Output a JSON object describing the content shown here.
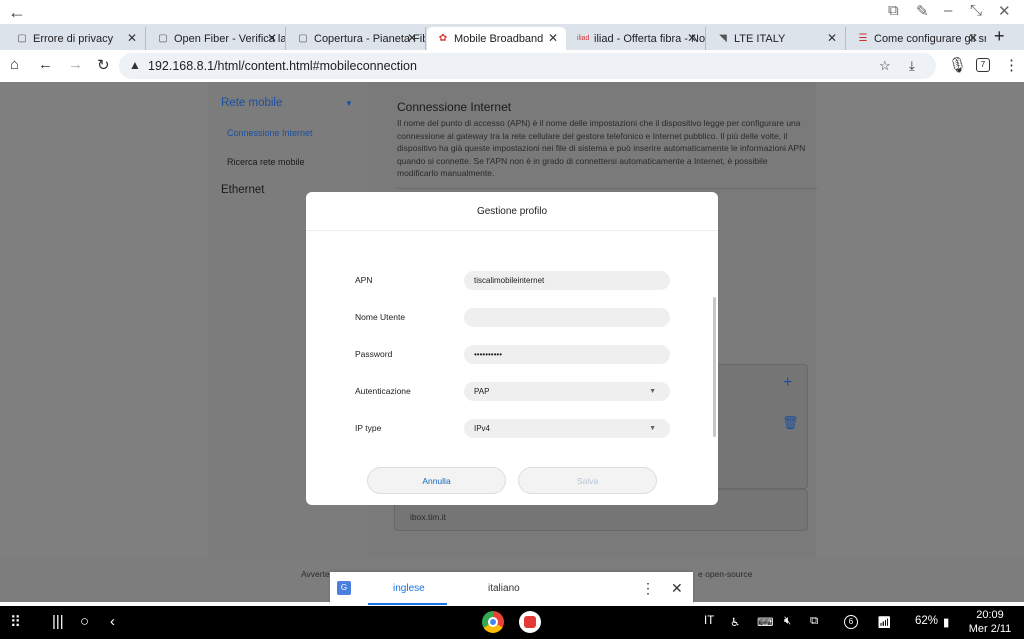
{
  "tabs": [
    {
      "label": "Errore di privacy",
      "icon": "doc-icon",
      "active": false
    },
    {
      "label": "Open Fiber - Verifica la c",
      "icon": "doc-icon",
      "active": false
    },
    {
      "label": "Copertura - Pianeta Fibr",
      "icon": "doc-icon",
      "active": false
    },
    {
      "label": "Mobile Broadband",
      "icon": "huawei-icon",
      "active": true
    },
    {
      "label": "iliad - Offerta fibra - Nor",
      "icon": "iliad-icon",
      "active": false
    },
    {
      "label": "LTE ITALY",
      "icon": "rss-icon",
      "active": false
    },
    {
      "label": "Come configurare gli sm",
      "icon": "site-icon",
      "active": false
    }
  ],
  "toolbar": {
    "url": "192.168.8.1/html/content.html#mobileconnection",
    "tab_count": "7"
  },
  "sidebar": {
    "section1": "Rete mobile",
    "item1": "Connessione Internet",
    "item2": "Ricerca rete mobile",
    "section2": "Ethernet"
  },
  "content": {
    "title": "Connessione Internet",
    "description": "Il nome del punto di accesso (APN) è il nome delle impostazioni che il dispositivo legge per configurare una connessione al gateway tra la rete cellulare del gestore telefonico e Internet pubblico. Il più delle volte, il dispositivo ha già queste impostazioni nei file di sistema e può inserire automaticamente le informazioni APN quando si connette. Se l'APN non è in grado di connettersi automaticamente a Internet, è possibile modificarlo manualmente.",
    "apn_partial": "ibox.tim.it"
  },
  "footer": {
    "left": "Avverte",
    "right": "e open-source"
  },
  "modal": {
    "title": "Gestione profilo",
    "fields": {
      "apn_label": "APN",
      "apn_value": "tiscalimobileinternet",
      "user_label": "Nome Utente",
      "user_value": "",
      "password_label": "Password",
      "password_value": "••••••••••",
      "auth_label": "Autenticazione",
      "auth_value": "PAP",
      "iptype_label": "IP type",
      "iptype_value": "IPv4"
    },
    "cancel": "Annulla",
    "save": "Salva"
  },
  "translate": {
    "from": "inglese",
    "to": "italiano"
  },
  "statusbar": {
    "lang": "IT",
    "notif_count": "6",
    "battery": "62%",
    "time": "20:09",
    "date": "Mer 2/11"
  },
  "colors": {
    "accent": "#1a73e8",
    "modal_link": "#1565c0"
  }
}
